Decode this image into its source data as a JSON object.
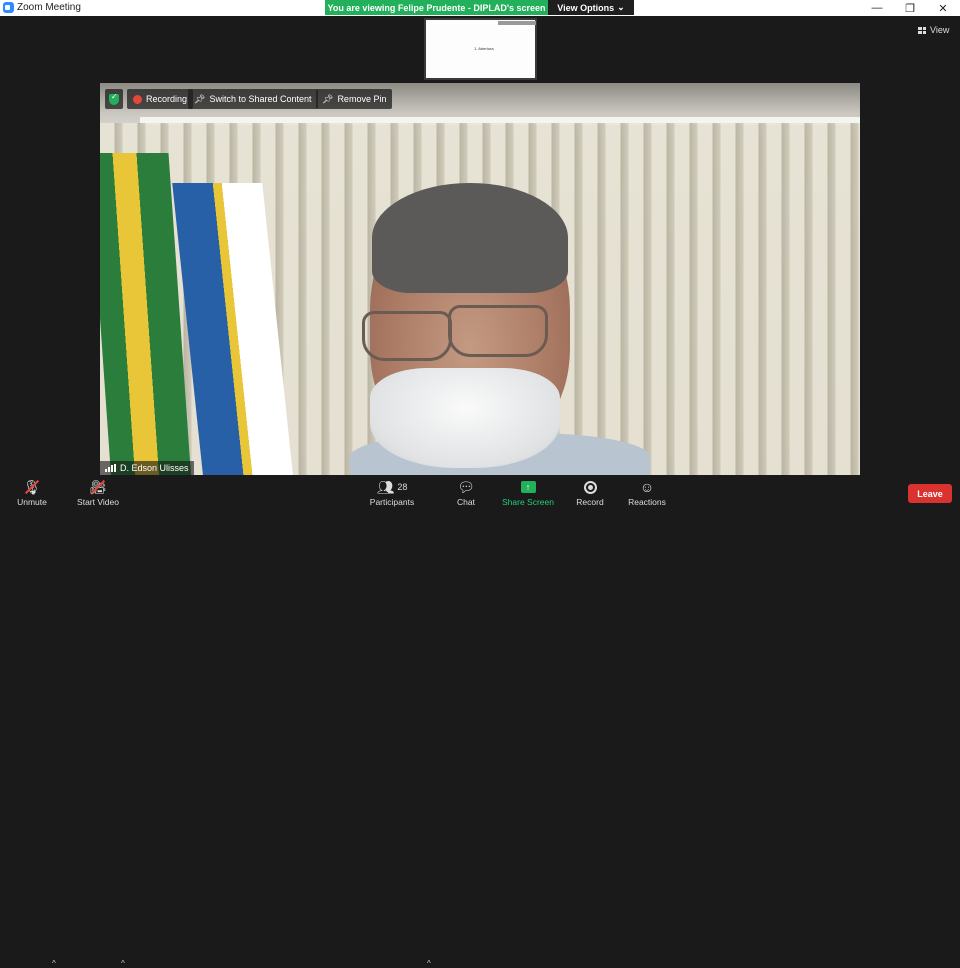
{
  "window": {
    "title": "Zoom Meeting",
    "minimize_icon": "minimize-icon",
    "maximize_icon": "restore-icon",
    "close_icon": "close-icon"
  },
  "banner": {
    "text": "You are viewing Felipe Prudente - DIPLAD's screen",
    "view_options_label": "View Options",
    "color": "#23b05b"
  },
  "thumbnail": {
    "text": "1. Abertura"
  },
  "view_button": {
    "label": "View"
  },
  "video_overlay": {
    "recording_label": "Recording",
    "switch_label": "Switch to Shared Content",
    "remove_pin_label": "Remove Pin"
  },
  "participant": {
    "name": "D. Edson Ulisses"
  },
  "toolbar": {
    "unmute_label": "Unmute",
    "start_video_label": "Start Video",
    "participants_label": "Participants",
    "participants_count": "28",
    "chat_label": "Chat",
    "share_label": "Share Screen",
    "record_label": "Record",
    "reactions_label": "Reactions",
    "leave_label": "Leave",
    "leave_color": "#d9322f"
  }
}
